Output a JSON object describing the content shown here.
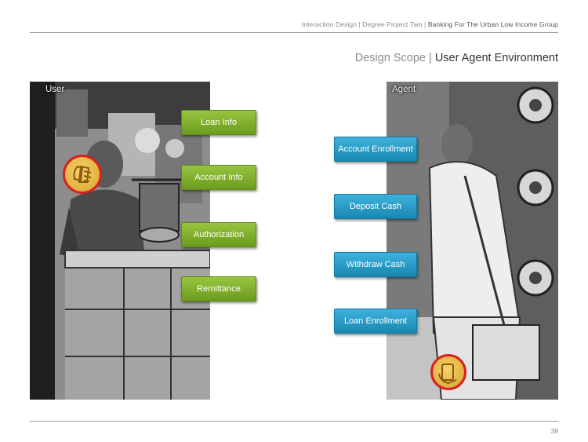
{
  "header": {
    "prefix": "Interaction Design |  Degree Project Two |",
    "title": "Banking For The Urban Low Income Group"
  },
  "page_title": {
    "prefix": "Design Scope |",
    "title": "User Agent Environment"
  },
  "user_panel": {
    "label": "User",
    "options": [
      "Loan Info",
      "Account Info",
      "Authorization",
      "Remittance"
    ],
    "accent": "#7fb22f"
  },
  "agent_panel": {
    "label": "Agent",
    "options": [
      "Account Enrollment",
      "Deposit Cash",
      "Withdraw Cash",
      "Loan Enrollment"
    ],
    "accent": "#2a9fcf"
  },
  "page_number": "38"
}
